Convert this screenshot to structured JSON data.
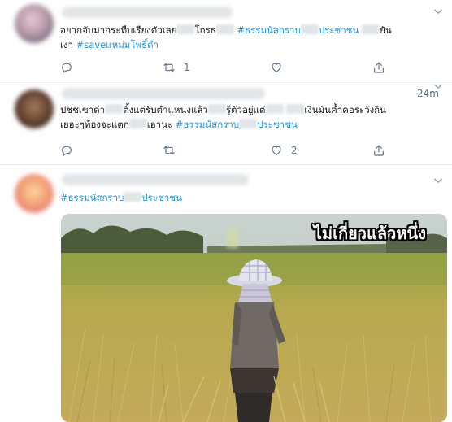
{
  "tweets": [
    {
      "text_lines": [
        {
          "parts": [
            {
              "t": "อยากจับมากระทืบเรียงตัวเลย"
            },
            {
              "redact": true
            },
            {
              "t": "โกรธ"
            },
            {
              "redact": true
            },
            {
              "t": " "
            },
            {
              "hashtag": "#ธรรมนัสกราบ"
            },
            {
              "redact": true
            },
            {
              "hashtag": "ประชาชน"
            },
            {
              "t": " "
            },
            {
              "redact": true
            },
            {
              "t": "ยัน"
            }
          ]
        },
        {
          "parts": [
            {
              "t": "เงา "
            },
            {
              "hashtag": "#saveแหม่มโพธิ์ดำ"
            }
          ]
        }
      ],
      "actions": {
        "reply": "",
        "retweet": "1",
        "like": "",
        "share": ""
      }
    },
    {
      "timestamp": "24m",
      "text_lines": [
        {
          "parts": [
            {
              "t": "ปชชเขาด่า"
            },
            {
              "redact": true
            },
            {
              "t": "ตั้งแต่รับตำแหน่งแล้ว"
            },
            {
              "redact": true
            },
            {
              "t": "รู้ตัวอยู่แต่"
            },
            {
              "redact": true
            },
            {
              "t": " "
            },
            {
              "redact": true
            },
            {
              "t": "เงินมันค้ำคอระวังกิน"
            }
          ]
        },
        {
          "parts": [
            {
              "t": "เยอะๆท้องจะแตก"
            },
            {
              "redact": true
            },
            {
              "t": "เอานะ "
            },
            {
              "hashtag": "#ธรรมนัสกราบ"
            },
            {
              "redact": true
            },
            {
              "hashtag": "ประชาชน"
            }
          ]
        }
      ],
      "actions": {
        "reply": "",
        "retweet": "",
        "like": "2",
        "share": ""
      }
    },
    {
      "text_lines": [
        {
          "parts": [
            {
              "hashtag": "#ธรรมนัสกราบ"
            },
            {
              "redact": true
            },
            {
              "hashtag": "ประชาชน"
            }
          ]
        }
      ],
      "media": {
        "caption": "ไม่เกี่ยวแล้วหนึ่ง",
        "description_icon": "photo"
      }
    }
  ],
  "colors": {
    "hashtag": "#1b95e0",
    "text": "#0f1419",
    "muted": "#5b7083",
    "divider": "#e6ecf0"
  },
  "icons": [
    "reply-icon",
    "retweet-icon",
    "like-icon",
    "share-icon",
    "chevron-down-icon"
  ]
}
